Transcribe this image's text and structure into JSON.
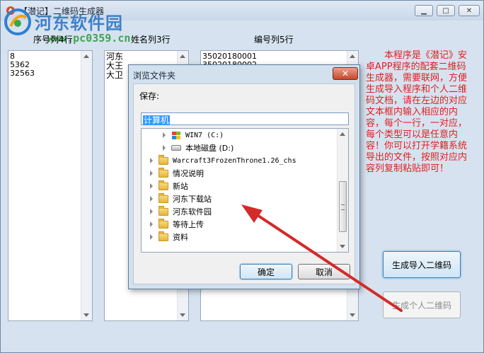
{
  "window": {
    "title": "【潜记】二维码生成器",
    "minimize_glyph": "▁",
    "maximize_glyph": "□",
    "close_glyph": "✕"
  },
  "watermark": {
    "text": "河东软件园",
    "url": "www.pc0359.cn"
  },
  "columns": [
    {
      "header": "序号列4行",
      "lines": [
        "8",
        "5362",
        "32563"
      ]
    },
    {
      "header": "姓名列3行",
      "lines": [
        "河东",
        "大王",
        "大卫"
      ]
    },
    {
      "header": "编号列5行",
      "lines": [
        "35020180001",
        "35020180002"
      ]
    }
  ],
  "description": "本程序是《潜记》安卓APP程序的配套二维码生成器，需要联网，方便生成导入程序和个人二维码文档，请在左边的对应文本框内输入相应的内容，每个一行，一对应，每个类型可以是任意内容！你可以打开学籍系统导出的文件，按照对应内容列复制粘贴即可！",
  "buttons": {
    "generate_import": "生成导入二维码",
    "generate_personal": "生成个人二维码"
  },
  "dialog": {
    "title": "浏览文件夹",
    "close_glyph": "✕",
    "label": "保存:",
    "input_value": "计算机",
    "tree": [
      {
        "label": "WIN7 (C:)",
        "icon": "windows-drive-icon",
        "level": 1
      },
      {
        "label": "本地磁盘 (D:)",
        "icon": "hard-drive-icon",
        "level": 1
      },
      {
        "label": "Warcraft3FrozenThrone1.26_chs",
        "icon": "folder-icon",
        "level": 0
      },
      {
        "label": "情况说明",
        "icon": "folder-icon",
        "level": 0
      },
      {
        "label": "新站",
        "icon": "folder-icon",
        "level": 0
      },
      {
        "label": "河东下载站",
        "icon": "folder-icon",
        "level": 0
      },
      {
        "label": "河东软件园",
        "icon": "folder-icon",
        "level": 0
      },
      {
        "label": "等待上传",
        "icon": "folder-icon",
        "level": 0
      },
      {
        "label": "资料",
        "icon": "folder-icon",
        "level": 0
      }
    ],
    "ok": "确定",
    "cancel": "取消"
  },
  "colors": {
    "description_text": "#e02020",
    "annotation_arrow": "#d42a2a",
    "selection": "#3399ff"
  }
}
